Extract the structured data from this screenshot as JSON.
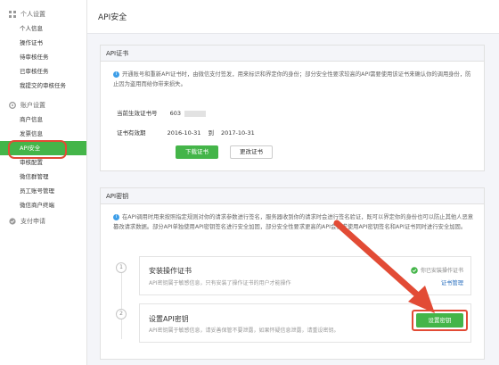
{
  "sidebar": {
    "sections": [
      {
        "title": "个人设置",
        "icon": "grid-icon",
        "items": [
          "个人信息",
          "操作证书",
          "待审核任务",
          "已审核任务",
          "我提交的审核任务"
        ]
      },
      {
        "title": "账户设置",
        "icon": "gear-icon",
        "items": [
          "商户信息",
          "发票信息",
          "API安全",
          "审核配置",
          "微信群管理",
          "员工账号管理",
          "微信商户终端"
        ]
      },
      {
        "title": "支付申请",
        "icon": "check-icon",
        "items": []
      }
    ],
    "active_item": "API安全"
  },
  "header": {
    "title": "API安全"
  },
  "cert_panel": {
    "title": "API证书",
    "notice": "开通账号和重新API证书时，由微信支付签发，用来标识和界定你的身份；部分安全性要求较高的API需要使用该证书来确认你的调用身份，防止因为盗用而给你带来损失。",
    "serial_label": "当前生效证书号",
    "serial_value": "603",
    "validity_label": "证书有效期",
    "validity_from": "2016-10-31",
    "validity_to_word": "到",
    "validity_to": "2017-10-31",
    "download_btn": "下载证书",
    "change_btn": "更改证书"
  },
  "key_panel": {
    "title": "API密钥",
    "notice": "在API调用时用来按照指定规则对你的请求参数进行签名，服务器收到你的请求时会进行签名验证，既可以界定你的身份也可以防止其他人恶意篡改请求数据。部分API单独使用API密钥签名进行安全加固，部分安全性要求更高的API会要求使用API密钥签名和API证书同时进行安全加固。",
    "steps": [
      {
        "no": "1",
        "title": "安装操作证书",
        "desc": "API密钥属于敏感信息，只有安装了操作证书的用户才能操作",
        "status": "你已安装操作证书",
        "link": "证书管理"
      },
      {
        "no": "2",
        "title": "设置API密钥",
        "desc": "API密钥属于敏感信息，请妥善保管不要泄露，如果怀疑信息泄露，请重设密钥。",
        "button": "设置密钥"
      }
    ]
  },
  "colors": {
    "accent": "#44b549",
    "highlight": "#e24b35",
    "info": "#3d9ee8"
  }
}
